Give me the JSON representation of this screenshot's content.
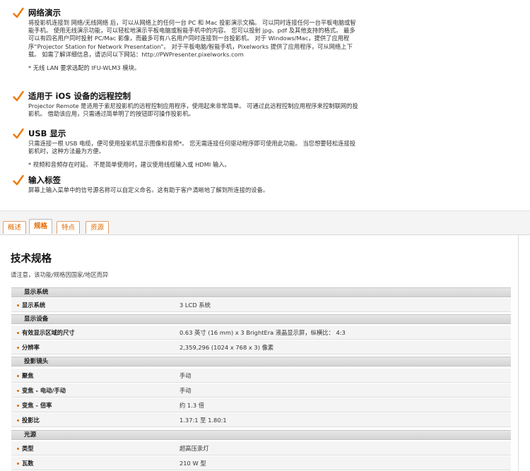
{
  "features": [
    {
      "title": "网络演示",
      "body": "将投影机连接到 网络/无线网络 后，可以从网络上的任何一台 PC 和 Mac 投影演示文稿。 可以同时连接任何一台平板电脑或智能手机。 使用无线演示功能，可以轻松地演示平板电脑或智能手机中的内容。 您可以投射 jpg、pdf 及其他支持的格式。 最多可以有四名用户同时投射 PC/Mac 影像，而最多可有八名用户同时连接到一台投影机。 对于 Windows/Mac，提供了应用程序“Projector Station for Network Presentation”。 对于平板电脑/智能手机，Pixelworks 提供了应用程序，可从网络上下载。 如需了解详细信息，请访问以下网站：http://PWPresenter.pixelworks.com",
      "note": "* 无线 LAN 要求选配的 IFU-WLM3 模块。"
    },
    {
      "title": "适用于 iOS 设备的远程控制",
      "body": "Projector Remote 是适用于索尼投影机的远程控制应用程序，使用起来非常简单。 可通过此远程控制应用程序来控制联网的投影机。 借助该应用，只需通过简单明了的按钮即可操作投影机。",
      "note": ""
    },
    {
      "title": "USB 显示",
      "body": "只需连接一根 USB 电缆，便可使用投影机显示图像和音频*。 您无需连接任何驱动程序即可使用此功能。 当您想要轻松连接投影机时，这种方法最为方便。",
      "note": "* 视频和音频存在时延。 不是简单使用时，建议使用线缆输入或 HDMI 输入。"
    },
    {
      "title": "输入标签",
      "body": "屏幕上输入菜单中的信号源名称可以自定义命名。这有助于客户清晰地了解到所连接的设备。",
      "note": ""
    }
  ],
  "tabs": [
    {
      "label": "概述"
    },
    {
      "label": "规格"
    },
    {
      "label": "特点"
    },
    {
      "label": "资源"
    }
  ],
  "spec": {
    "title": "技术规格",
    "note": "请注意，该功能/规格因国家/地区而异",
    "groups": [
      {
        "name": "显示系统",
        "rows": [
          {
            "label": "显示系统",
            "value": "3 LCD 系统"
          }
        ]
      },
      {
        "name": "显示设备",
        "rows": [
          {
            "label": "有效显示区域的尺寸",
            "value": "0.63 英寸 (16 mm) x 3 BrightEra 液晶显示屏，纵横比： 4:3"
          },
          {
            "label": "分辨率",
            "value": "2,359,296 (1024 x 768 x 3) 像素"
          }
        ]
      },
      {
        "name": "投影镜头",
        "rows": [
          {
            "label": "聚焦",
            "value": "手动"
          },
          {
            "label": "变焦 - 电动/手动",
            "value": "手动"
          },
          {
            "label": "变焦 - 倍率",
            "value": "约 1.3 倍"
          },
          {
            "label": "投影比",
            "value": "1.37:1 至 1.80:1"
          }
        ]
      },
      {
        "name": "光源",
        "rows": [
          {
            "label": "类型",
            "value": "超高压汞灯"
          },
          {
            "label": "瓦数",
            "value": "210 W 型"
          }
        ]
      }
    ]
  },
  "colors": {
    "accent": "#e06a00",
    "check": "#f07800"
  },
  "icons": {
    "feature_bullet": "checkmark-icon",
    "row_bullet": "dot-icon"
  }
}
